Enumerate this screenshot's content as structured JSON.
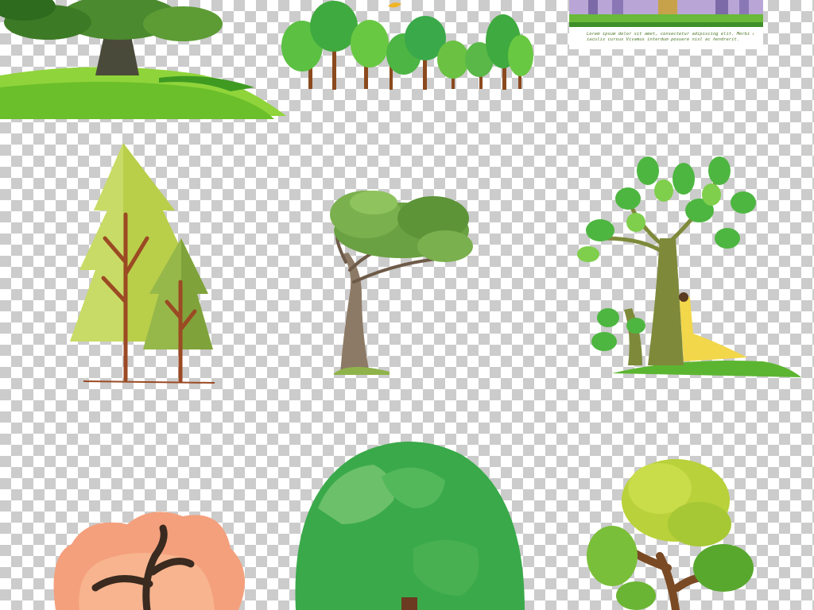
{
  "banner": {
    "lines": [
      "Lorem ipsum dolor sit amet, consectetur adipiscing elit. Morbi at turpis id leo",
      "iaculis cursus Vivamus interdum posuere nisl ac hendrerit."
    ]
  },
  "colors": {
    "background_light": "#ffffff",
    "background_dark": "#cccccc",
    "leaf_green": "#3aa94a",
    "grass_green": "#8fd43a",
    "trunk_brown": "#8b5a2b",
    "autumn_orange": "#f4a07c"
  },
  "icons": [
    "oak-tree-on-hill",
    "row-of-round-trees",
    "city-park-banner",
    "pine-trees-pair",
    "savanna-tree",
    "leafy-tree-with-woman",
    "autumn-tree",
    "round-bush-tree",
    "yellow-green-tree"
  ]
}
